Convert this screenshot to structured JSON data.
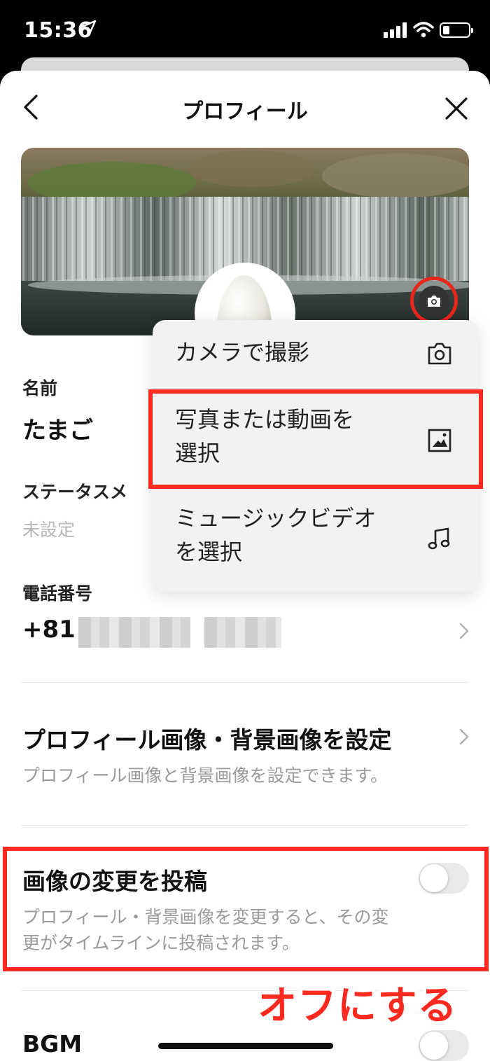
{
  "status_bar": {
    "time": "15:36"
  },
  "header": {
    "title": "プロフィール"
  },
  "fields": {
    "name_label": "名前",
    "name_value": "たまご",
    "status_label": "ステータスメ",
    "status_value": "未設定",
    "phone_label": "電話番号",
    "phone_prefix": "+81"
  },
  "menu": {
    "item1": "カメラで撮影",
    "item2_line1": "写真または動画を",
    "item2_line2": "選択",
    "item3_line1": "ミュージックビデオ",
    "item3_line2": "を選択"
  },
  "settings": {
    "profile_images_title": "プロフィール画像・背景画像を設定",
    "profile_images_desc": "プロフィール画像と背景画像を設定できます。",
    "post_change_title": "画像の変更を投稿",
    "post_change_desc_line1": "プロフィール・背景画像を変更すると、その変",
    "post_change_desc_line2": "更がタイムラインに投稿されます。",
    "post_change_enabled": false,
    "bgm_title": "BGM",
    "bgm_enabled": false
  },
  "annotation": {
    "text": "オフにする",
    "color": "#ff2a1f"
  },
  "icons": [
    "location-arrow-icon",
    "signal-icon",
    "wifi-icon",
    "battery-icon",
    "back-chevron-icon",
    "close-icon",
    "camera-icon",
    "image-icon",
    "music-note-icon",
    "chevron-right-icon"
  ]
}
